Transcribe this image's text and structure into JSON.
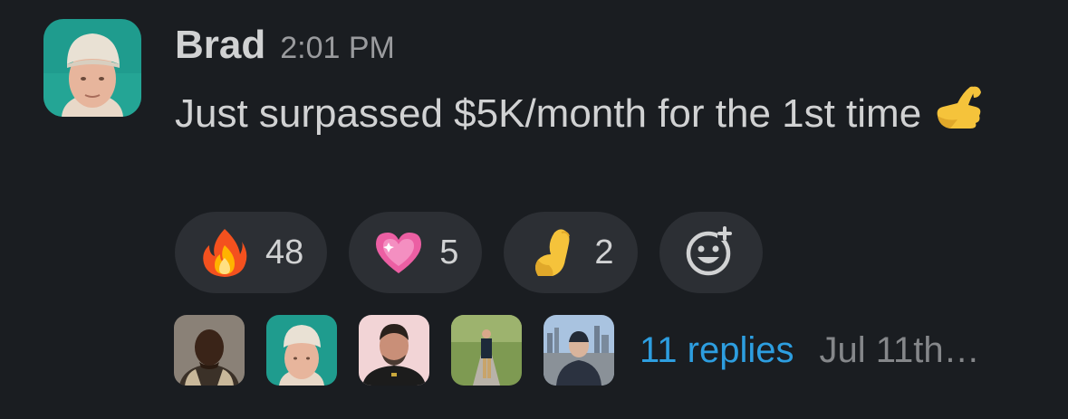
{
  "message": {
    "author": "Brad",
    "timestamp": "2:01 PM",
    "text": "Just surpassed $5K/month for the 1st time",
    "inline_emoji": "call-me-hand"
  },
  "reactions": [
    {
      "emoji": "fire",
      "count": "48"
    },
    {
      "emoji": "sparkling-heart",
      "count": "5"
    },
    {
      "emoji": "pinched-fingers",
      "count": "2"
    }
  ],
  "add_reaction_icon": "add-reaction-icon",
  "thread": {
    "participants": [
      "participant-1",
      "participant-2",
      "participant-3",
      "participant-4",
      "participant-5"
    ],
    "replies_label": "11 replies",
    "last_reply": "Jul 11th…"
  },
  "colors": {
    "background": "#1a1d21",
    "text": "#d1d2d3",
    "link": "#2d9ee0",
    "pill": "#2c2f34"
  }
}
